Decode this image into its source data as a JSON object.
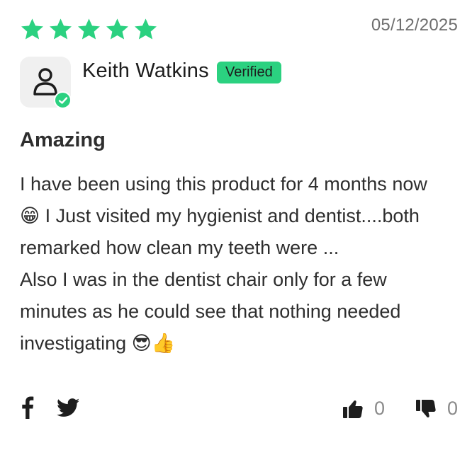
{
  "rating": {
    "stars": 5,
    "max": 5,
    "color": "#2bd180"
  },
  "date": "05/12/2025",
  "reviewer": {
    "name": "Keith Watkins",
    "badge": "Verified",
    "avatar_icon": "user-icon",
    "verified_icon": "check-circle-icon"
  },
  "review": {
    "title": "Amazing",
    "lines": [
      "I have been using this product for 4 months now",
      "😁 I Just visited my hygienist and dentist....both",
      "remarked how clean my teeth were ...",
      "Also I was in the dentist chair only for a few",
      "minutes as he could see that nothing needed",
      "investigating 😎👍"
    ]
  },
  "share": {
    "facebook_icon": "facebook-icon",
    "twitter_icon": "twitter-icon"
  },
  "votes": {
    "helpful_count": "0",
    "unhelpful_count": "0"
  }
}
